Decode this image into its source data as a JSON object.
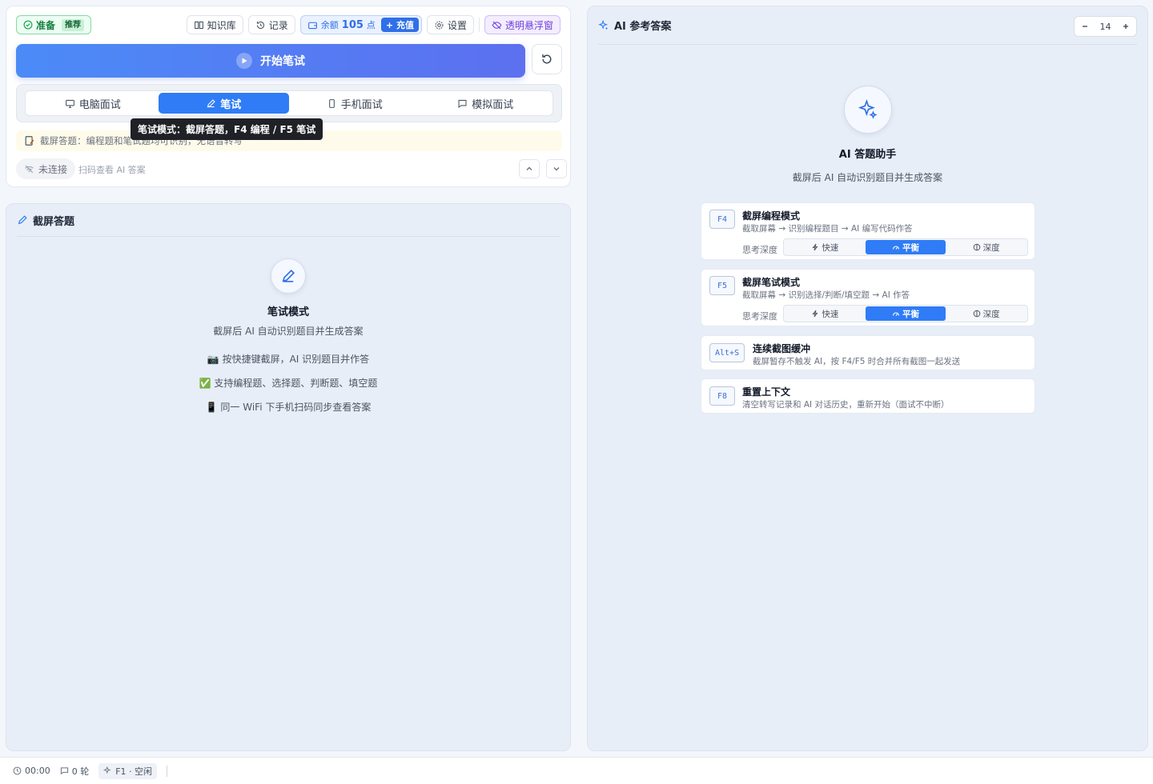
{
  "toolbar": {
    "status_label": "准备",
    "status_badge": "推荐",
    "knowledge_label": "知识库",
    "history_label": "记录",
    "balance_prefix": "余额",
    "balance_value": "105",
    "balance_unit": "点",
    "recharge_label": "+ 充值",
    "settings_label": "设置",
    "float_window_label": "透明悬浮窗"
  },
  "start_button": {
    "label": "开始笔试"
  },
  "modes": {
    "tabs": [
      {
        "label": "电脑面试",
        "icon": "monitor-icon"
      },
      {
        "label": "笔试",
        "icon": "pen-icon",
        "active": true
      },
      {
        "label": "手机面试",
        "icon": "phone-icon"
      },
      {
        "label": "模拟面试",
        "icon": "chat-icon"
      }
    ]
  },
  "tip": {
    "text": "截屏答题：编程题和笔试题均可识别，无语音转写"
  },
  "tooltip": {
    "text": "笔试模式：截屏答题，F4 编程 / F5 笔试"
  },
  "connection": {
    "status": "未连接",
    "hint": "扫码查看 AI 答案"
  },
  "screenshot_panel": {
    "title": "截屏答题",
    "empty_title": "笔试模式",
    "empty_subtitle": "截屏后 AI 自动识别题目并生成答案",
    "bullets": [
      "📷 按快捷键截屏，AI 识别题目并作答",
      "✅ 支持编程题、选择题、判断题、填空题",
      "📱 同一 WiFi 下手机扫码同步查看答案"
    ]
  },
  "ai_panel": {
    "title": "AI 参考答案",
    "font_size": "14",
    "assistant_title": "AI 答题助手",
    "assistant_subtitle": "截屏后 AI 自动识别题目并生成答案",
    "depth_label": "思考深度",
    "depth_options": [
      "快速",
      "平衡",
      "深度"
    ],
    "shortcuts": [
      {
        "key": "F4",
        "title": "截屏编程模式",
        "desc": "截取屏幕 → 识别编程题目 → AI 编写代码作答",
        "has_depth": true
      },
      {
        "key": "F5",
        "title": "截屏笔试模式",
        "desc": "截取屏幕 → 识别选择/判断/填空题 → AI 作答",
        "has_depth": true
      },
      {
        "key": "Alt+S",
        "title": "连续截图缓冲",
        "desc": "截屏暂存不触发 AI，按 F4/F5 时合并所有截图一起发送"
      },
      {
        "key": "F8",
        "title": "重置上下文",
        "desc": "清空转写记录和 AI 对话历史，重新开始（面试不中断）"
      }
    ]
  },
  "status_bar": {
    "timer": "00:00",
    "rounds": "0 轮",
    "hotkey_state": "F1 · 空闲"
  },
  "colors": {
    "primary": "#2f7cf6",
    "success": "#15803d",
    "purple": "#6d3fd9",
    "panel_bg": "#e8eef7"
  }
}
